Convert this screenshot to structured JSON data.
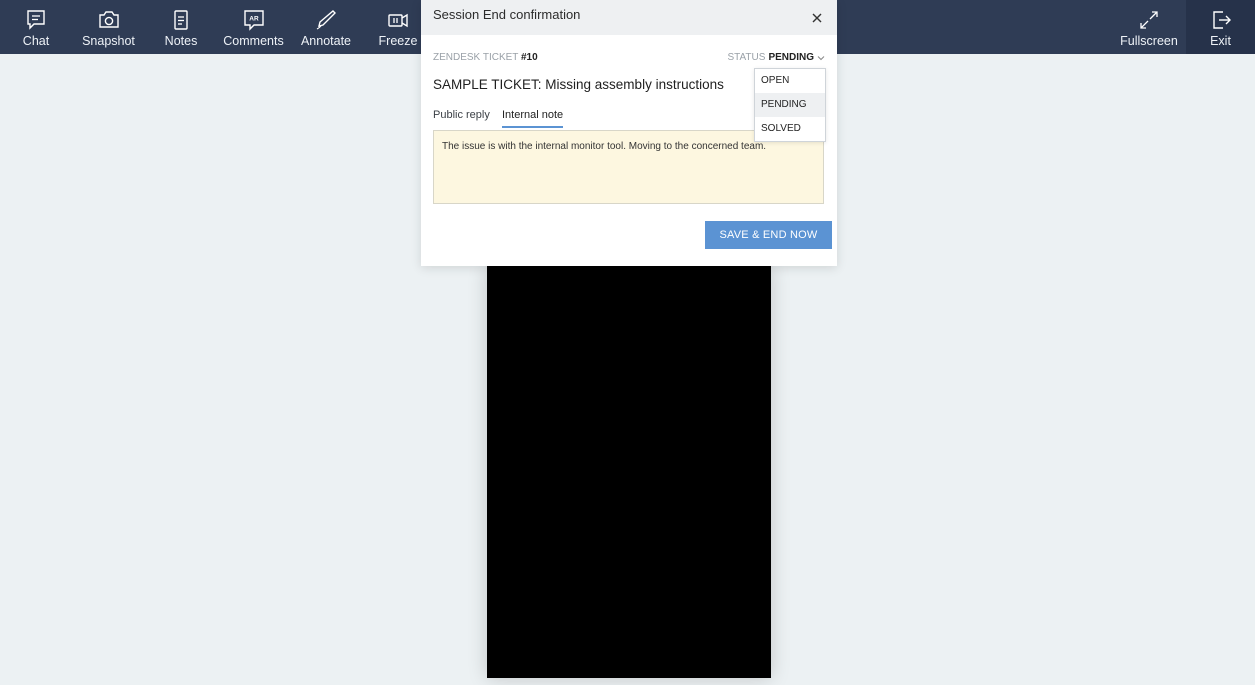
{
  "toolbar": {
    "items": [
      {
        "label": "Chat",
        "icon": "chat-icon"
      },
      {
        "label": "Snapshot",
        "icon": "camera-icon"
      },
      {
        "label": "Notes",
        "icon": "notes-icon"
      },
      {
        "label": "Comments",
        "icon": "ar-comment-icon"
      },
      {
        "label": "Annotate",
        "icon": "pen-icon"
      },
      {
        "label": "Freeze",
        "icon": "freeze-icon"
      }
    ],
    "fullscreen_label": "Fullscreen",
    "exit_label": "Exit"
  },
  "dialog": {
    "title": "Session End confirmation",
    "ticket_prefix": "ZENDESK TICKET",
    "ticket_number": "#10",
    "status_label": "STATUS",
    "status_value": "PENDING",
    "subject": "SAMPLE TICKET: Missing assembly instructions",
    "tabs": [
      {
        "label": "Public reply",
        "active": false
      },
      {
        "label": "Internal note",
        "active": true
      }
    ],
    "note_text": "The issue is with the internal monitor tool. Moving to the concerned team.",
    "save_button": "SAVE & END NOW",
    "status_options": [
      "OPEN",
      "PENDING",
      "SOLVED"
    ],
    "selected_status": "PENDING"
  },
  "colors": {
    "topbar": "#2f3c55",
    "accent": "#5b93d3",
    "note_bg": "#fdf7e0"
  }
}
